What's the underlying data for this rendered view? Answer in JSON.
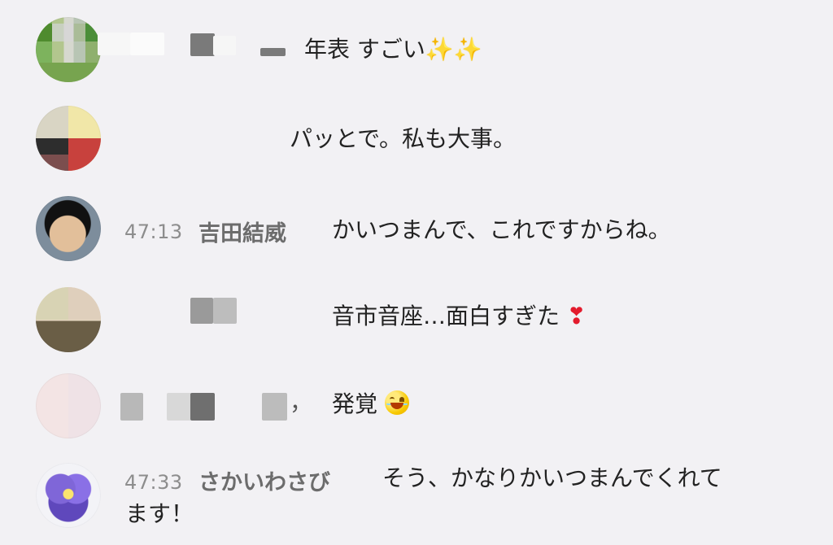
{
  "messages": [
    {
      "text": "年表 すごい"
    },
    {
      "text": "パッとで。私も大事。"
    },
    {
      "time": "47:13",
      "name": "吉田結威",
      "text": "かいつまんで、これですからね。"
    },
    {
      "text": "音市音座…面白すぎた"
    },
    {
      "text_suffix": "，",
      "text": "発覚"
    },
    {
      "time": "47:33",
      "name": "さかいわさび",
      "text_line_1": "そう、かなりかいつまんでくれて",
      "text_line_2": "ます！"
    }
  ],
  "emoji": {
    "sparkles": "✨✨",
    "heart": "❣"
  },
  "colors": {
    "background": "#f2f1f4",
    "text": "#222222",
    "meta": "#8d8d8d",
    "name": "#6c6c6c"
  }
}
